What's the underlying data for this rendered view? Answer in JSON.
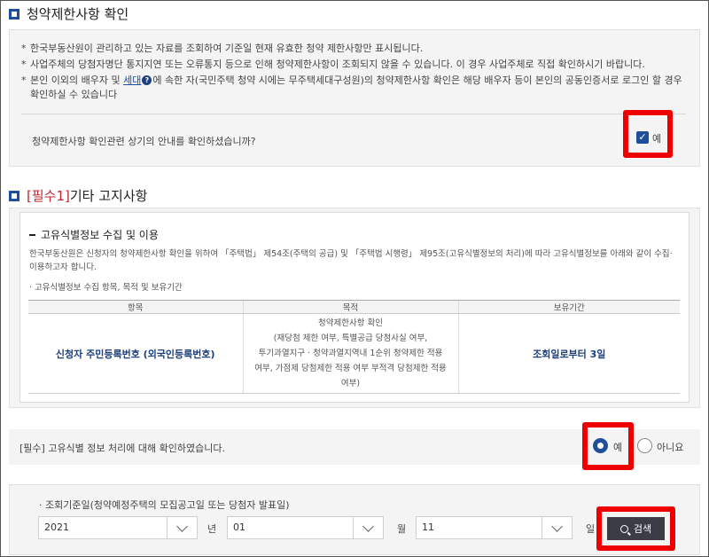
{
  "section1": {
    "title": "청약제한사항 확인",
    "notes": [
      "한국부동산원이 관리하고 있는 자료를 조회하여 기준일 현재 유효한 청약 제한사항만 표시됩니다.",
      "사업주체의 당첨자명단 통지지연 또는 오류통지 등으로 인해 청약제한사항이 조회되지 않을 수 있습니다. 이 경우 사업주체로 직접 확인하시기 바랍니다."
    ],
    "note3_pre": "본인 이외의 배우자 및 ",
    "note3_link": "세대",
    "note3_icon": "?",
    "note3_post": "에 속한 자(국민주택 청약 시에는 무주택세대구성원)의 청약제한사항 확인은 해당 배우자 등이 본인의 공동인증서로 로그인 할 경우",
    "note3_line2": "확인하실 수 있습니다",
    "question": "청약제한사항 확인관련 상기의 안내를 확인하셨습니까?",
    "checkbox_label": "예",
    "checkbox_checked": true
  },
  "section2": {
    "title_required": "[필수1]",
    "title_rest": " 기타 고지사항",
    "subtitle": "고유식별정보 수집 및 이용",
    "intro_line1": "한국부동산원은 신청자의 청약제한사항 확인을 위하여 「주택법」 제54조(주택의 공급) 및 「주택법 시행령」 제95조(고유식별정보의 처리)에 따라 고유식별정보를 아래와 같이 수집·",
    "intro_line2": "이용하고자 합니다.",
    "table_caption": "· 고유식별정보 수집 항목, 목적 및 보유기간",
    "table": {
      "headers": [
        "항목",
        "목적",
        "보유기간"
      ],
      "item": "신청자 주민등록번호 (외국인등록번호)",
      "purpose_lines": [
        "청약제한사항 확인",
        "(재당첨 제한 여부, 특별공급 당첨사실 여부,",
        "투기과열지구 · 청약과열지역내 1순위 청약제한 적용",
        "여부, 가점제 당첨제한 적용 여부 부적격 당첨제한 적용",
        "여부)"
      ],
      "period": "조회일로부터 3일"
    },
    "confirm_text": "[필수] 고유식별 정보 처리에 대해 확인하였습니다.",
    "radio_yes": "예",
    "radio_no": "아니요",
    "selected": "예"
  },
  "search": {
    "label": "· 조회기준일(청약예정주택의 모집공고일 또는 당첨자 발표일)",
    "year": "2021",
    "year_unit": "년",
    "month": "01",
    "month_unit": "월",
    "day": "11",
    "day_unit": "일",
    "button": "검색"
  },
  "colors": {
    "accent": "#1f4f9b",
    "highlight": "#ee0000",
    "required": "#c0262d",
    "button": "#3a3d46"
  }
}
